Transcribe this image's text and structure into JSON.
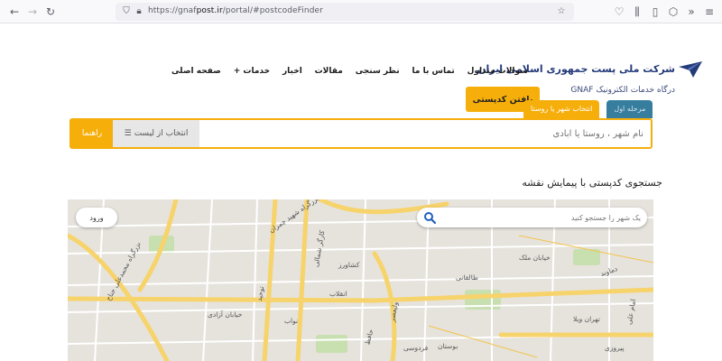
{
  "browser": {
    "url_prefix": "https://gnaf",
    "url_domain": "post.ir",
    "url_path": "/portal/#postcodeFinder"
  },
  "header": {
    "logo_title": "شرکت ملی پست جمهوری اسلامی ایران",
    "logo_subtitle": "درگاه خدمات الکترونیک GNAF",
    "nav": [
      "صفحه اصلی",
      "خدمات",
      "اخبار",
      "مقالات",
      "نظر سنجی",
      "تماس با ما",
      "سوالات متداول"
    ],
    "services_plus": "+",
    "cta_label": "یافتن کدپستی"
  },
  "finder": {
    "tab_city": "انتخاب شهر یا روستا",
    "tab_step": "مرحله اول",
    "input_placeholder": "نام شهر ، روستا یا آبادی",
    "list_button": "انتخاب از لیست",
    "guide_button": "راهنما"
  },
  "map": {
    "title": "جستجوی کدپستی با پیمایش نقشه",
    "search_placeholder": "یک شهر را جستجو کنید",
    "login_label": "ورود",
    "labels": [
      "بزرگراه شهید چمران",
      "کارگر شمالی",
      "خیابان آزادی",
      "بزرگراه محمدعلی جناح",
      "ولیعصر",
      "خیابان ملک",
      "دماوند",
      "پیروزی",
      "بوستان",
      "حافظ",
      "توحید",
      "نواب",
      "تهران ویلا",
      "فردوسی",
      "کشاورز",
      "انقلاب",
      "امام علی",
      "طالقانی"
    ],
    "colors": {
      "major_road": "#f7d36b",
      "minor_road": "#ffffff",
      "park": "#c8dfb0"
    }
  },
  "colors": {
    "accent": "#f6ae0b",
    "step_tab": "#367d9e",
    "brand": "#243b7a"
  }
}
